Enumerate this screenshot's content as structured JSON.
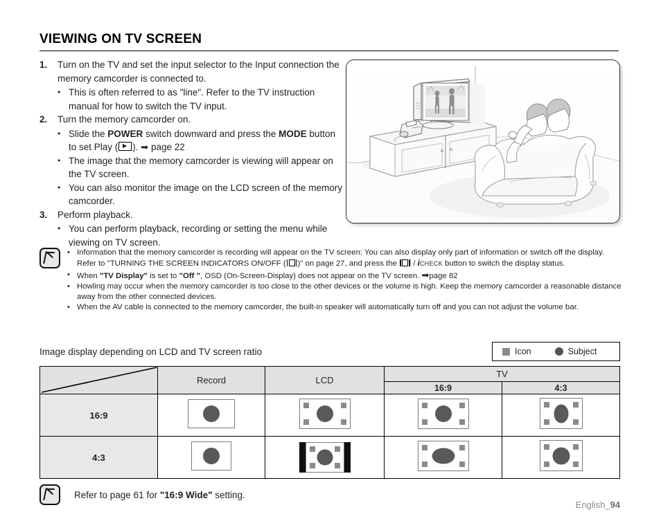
{
  "heading": "VIEWING ON TV SCREEN",
  "steps": [
    {
      "num": "1.",
      "text": "Turn on the TV and set the input selector to the Input connection the memory camcorder is connected to.",
      "subs": [
        {
          "parts": [
            {
              "t": "This is often referred to as \"line\". Refer to the TV instruction manual for how to switch the TV input."
            }
          ]
        }
      ]
    },
    {
      "num": "2.",
      "text": "Turn the memory camcorder on.",
      "subs": [
        {
          "parts": [
            {
              "t": "Slide the "
            },
            {
              "t": "POWER",
              "b": true
            },
            {
              "t": " switch downward and press the "
            },
            {
              "t": "MODE",
              "b": true
            },
            {
              "t": " button to set Play ("
            },
            {
              "icon": "play-icon"
            },
            {
              "t": "). "
            },
            {
              "icon": "arrow-icon"
            },
            {
              "t": " page 22"
            }
          ]
        },
        {
          "parts": [
            {
              "t": "The image that the memory camcorder is viewing will appear on the TV screen."
            }
          ]
        },
        {
          "parts": [
            {
              "t": "You can also monitor the image on the LCD screen of the memory camcorder."
            }
          ]
        }
      ]
    },
    {
      "num": "3.",
      "text": "Perform playback.",
      "subs": [
        {
          "parts": [
            {
              "t": "You can perform playback, recording or setting the menu while viewing on TV screen."
            }
          ]
        }
      ]
    }
  ],
  "illustration": {
    "alt": "Living room with TV on cabinet, camcorder connected, two people watching on a sofa"
  },
  "note_top": {
    "bullets": [
      {
        "parts": [
          {
            "t": "Information that the memory camcorder is recording will appear on the TV screen: You can also display only part of information or switch off the display. Refer to \"TURNING THE SCREEN INDICATORS ON/OFF ("
          },
          {
            "icon": "display-icon"
          },
          {
            "t": ")\" on page 27, and press the "
          },
          {
            "icon": "display-icon"
          },
          {
            "t": " / "
          },
          {
            "t": "i",
            "icheck": true
          },
          {
            "t": "CHECK",
            "chk": true
          },
          {
            "t": " button to switch the display status."
          }
        ]
      },
      {
        "parts": [
          {
            "t": "When "
          },
          {
            "t": "\"TV Display\"",
            "b": true
          },
          {
            "t": " is set to "
          },
          {
            "t": "\"Off \"",
            "b": true
          },
          {
            "t": ", OSD (On-Screen-Display) does not appear on the TV screen. "
          },
          {
            "icon": "arrow-icon"
          },
          {
            "t": "page 82"
          }
        ]
      },
      {
        "parts": [
          {
            "t": "Howling may occur when the memory camcorder is too close to the other devices or the volume is high. Keep the memory camcorder a reasonable distance away from the other connected devices."
          }
        ]
      },
      {
        "parts": [
          {
            "t": "When the AV cable is connected to the memory camcorder, the built-in speaker will automatically turn off and you can not adjust the volume bar."
          }
        ]
      }
    ]
  },
  "section_title": "Image display depending on LCD and TV screen ratio",
  "legend": {
    "icon_label": "Icon",
    "subject_label": "Subject",
    "icon_color": "#8a8a8a",
    "subject_color": "#555555"
  },
  "table": {
    "headers": {
      "record": "Record",
      "lcd": "LCD",
      "tv": "TV",
      "tv_169": "16:9",
      "tv_43": "4:3"
    },
    "rows": [
      {
        "label": "16:9"
      },
      {
        "label": "4:3"
      }
    ]
  },
  "foot_note": {
    "parts": [
      {
        "t": "Refer to page 61 for "
      },
      {
        "t": "\"16:9 Wide\"",
        "b": true
      },
      {
        "t": " setting."
      }
    ]
  },
  "page_label": "English_",
  "page_number": "94"
}
